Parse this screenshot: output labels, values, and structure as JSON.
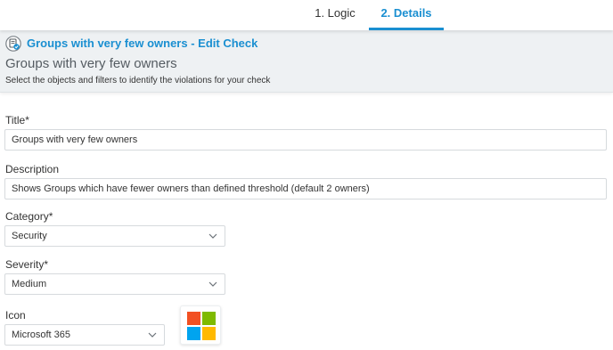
{
  "tabs": [
    {
      "label": "1. Logic",
      "active": false
    },
    {
      "label": "2. Details",
      "active": true
    }
  ],
  "header": {
    "breadcrumb": "Groups with very few owners - Edit Check",
    "title": "Groups with very few owners",
    "subtitle": "Select the objects and filters to identify the violations for your check"
  },
  "form": {
    "title_label": "Title*",
    "title_value": "Groups with very few owners",
    "description_label": "Description",
    "description_value": "Shows Groups which have fewer owners than defined threshold (default 2 owners)",
    "category_label": "Category*",
    "category_value": "Security",
    "severity_label": "Severity*",
    "severity_value": "Medium",
    "icon_label": "Icon",
    "icon_value": "Microsoft 365",
    "icon_preview": "microsoft-logo-icon"
  },
  "colors": {
    "accent": "#1a8fd1",
    "ms_red": "#f25022",
    "ms_green": "#7fba00",
    "ms_blue": "#00a4ef",
    "ms_yellow": "#ffb900"
  }
}
